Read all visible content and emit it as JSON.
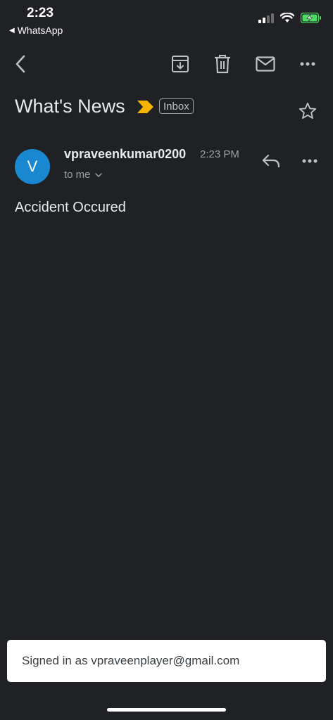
{
  "status_bar": {
    "time": "2:23",
    "back_app": "WhatsApp",
    "icons": [
      "cellular-signal-icon",
      "wifi-icon",
      "battery-charging-icon"
    ]
  },
  "toolbar": {
    "icons": [
      "back-arrow-icon",
      "archive-icon",
      "delete-icon",
      "mark-unread-icon",
      "more-icon"
    ]
  },
  "email": {
    "subject": "What's News",
    "label": "Inbox",
    "sender_initial": "V",
    "sender_name": "vpraveenkumar0200",
    "time": "2:23 PM",
    "recipient": "to me",
    "body": "Accident Occured"
  },
  "toast": {
    "message": "Signed in as vpraveenplayer@gmail.com"
  },
  "colors": {
    "background": "#202124",
    "avatar": "#1a88d1",
    "importance_marker": "#f4b400",
    "battery": "#4cd964"
  }
}
